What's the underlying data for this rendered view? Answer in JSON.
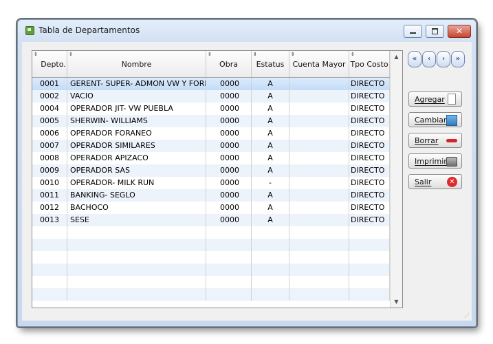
{
  "window": {
    "title": "Tabla de Departamentos",
    "close_glyph": "✕"
  },
  "table": {
    "headers": [
      "Depto.",
      "Nombre",
      "Obra",
      "Estatus",
      "Cuenta Mayor",
      "Tpo Costo"
    ],
    "rows": [
      [
        "0001",
        "GERENT- SUPER- ADMON VW Y FORD",
        "0000",
        "A",
        "",
        "DIRECTO"
      ],
      [
        "0002",
        "VACIO",
        "0000",
        "A",
        "",
        "DIRECTO"
      ],
      [
        "0004",
        "OPERADOR  JIT- VW  PUEBLA",
        "0000",
        "A",
        "",
        "DIRECTO"
      ],
      [
        "0005",
        "SHERWIN- WILLIAMS",
        "0000",
        "A",
        "",
        "DIRECTO"
      ],
      [
        "0006",
        "OPERADOR FORANEO",
        "0000",
        "A",
        "",
        "DIRECTO"
      ],
      [
        "0007",
        "OPERADOR SIMILARES",
        "0000",
        "A",
        "",
        "DIRECTO"
      ],
      [
        "0008",
        "OPERADOR APIZACO",
        "0000",
        "A",
        "",
        "DIRECTO"
      ],
      [
        "0009",
        "OPERADOR  SAS",
        "0000",
        "A",
        "",
        "DIRECTO"
      ],
      [
        "0010",
        "OPERADOR- MILK RUN",
        "0000",
        "-",
        "",
        "DIRECTO"
      ],
      [
        "0011",
        "BANKING- SEGLO",
        "0000",
        "A",
        "",
        "DIRECTO"
      ],
      [
        "0012",
        "BACHOCO",
        "0000",
        "A",
        "",
        "DIRECTO"
      ],
      [
        "0013",
        "SESE",
        "0000",
        "A",
        "",
        "DIRECTO"
      ]
    ],
    "selected_row": 0,
    "empty_rows": 6
  },
  "nav": {
    "first": "«",
    "prev": "‹",
    "next": "›",
    "last": "»"
  },
  "buttons": {
    "agregar": "Agregar",
    "cambiar": "Cambiar",
    "borrar": "Borrar",
    "imprimir": "Imprimir",
    "salir": "Salir",
    "salir_icon_glyph": "✕"
  },
  "icons": {
    "agregar": "new-document-icon",
    "cambiar": "edit-picture-icon",
    "borrar": "red-minus-icon",
    "imprimir": "printer-icon",
    "salir": "red-x-circle-icon"
  }
}
